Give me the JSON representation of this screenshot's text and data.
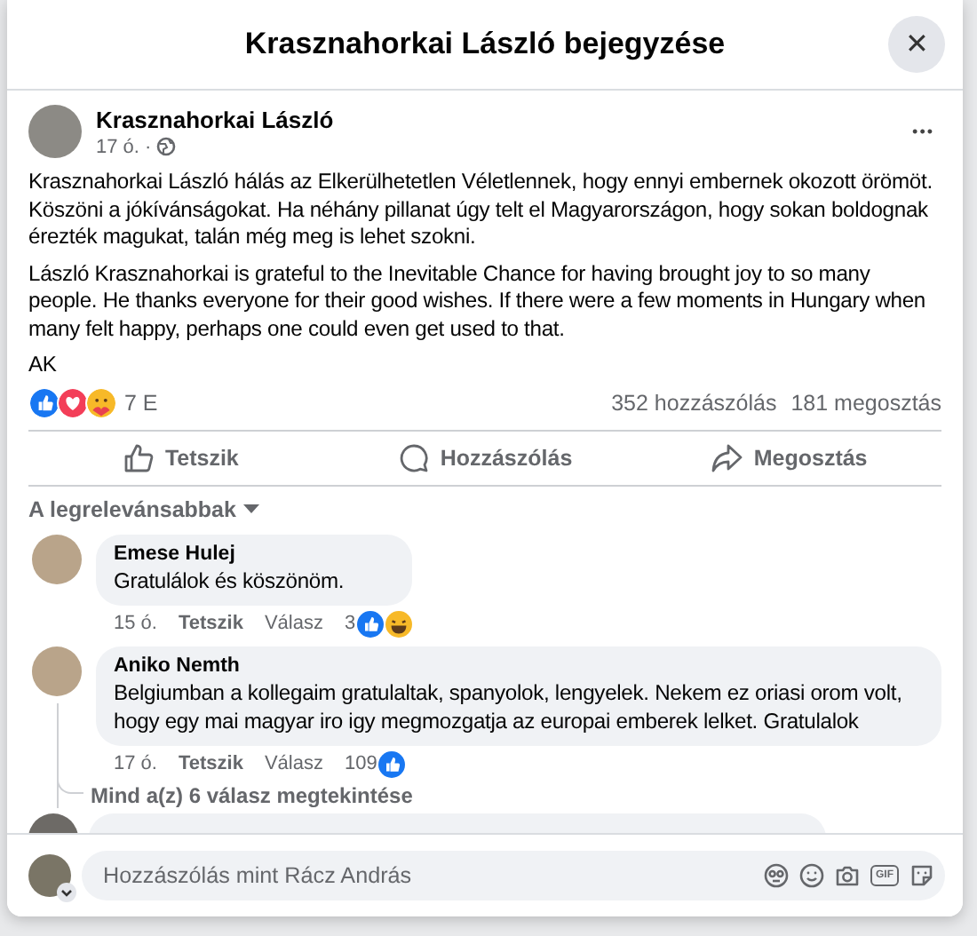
{
  "window": {
    "title": "Krasznahorkai László bejegyzése",
    "close": "✕"
  },
  "post": {
    "author": "Krasznahorkai László",
    "time": "17 ó. ·",
    "menu": "•••",
    "paragraphs": [
      "Krasznahorkai László hálás az Elkerülhetetlen Véletlennek, hogy ennyi embernek okozott örömöt. Köszöni a jókívánságokat. Ha néhány pillanat úgy telt el Magyarországon, hogy sokan boldognak érezték magukat, talán még meg is lehet szokni.",
      "László Krasznahorkai is grateful to the Inevitable Chance for having brought joy to so many people. He thanks everyone for their good wishes. If there were a few moments in Hungary when many felt happy, perhaps one could even get used to that.",
      "AK"
    ],
    "reactions": [
      {
        "kind": "like"
      },
      {
        "kind": "love"
      },
      {
        "kind": "care"
      }
    ],
    "reaction_count": "7 E",
    "comments_count": "352 hozzászólás",
    "shares_count": "181 megosztás",
    "actions": [
      {
        "kind": "like",
        "label": "Tetszik"
      },
      {
        "kind": "comment",
        "label": "Hozzászólás"
      },
      {
        "kind": "share",
        "label": "Megosztás"
      }
    ]
  },
  "sort": {
    "label": "A legrelevánsabbak"
  },
  "comments": [
    {
      "kind": "full",
      "author": "Emese Hulej",
      "text": "Gratulálok és köszönöm.",
      "time": "15 ó.",
      "like": "Tetszik",
      "reply": "Válasz",
      "count": "3",
      "reactions": [
        {
          "kind": "like"
        },
        {
          "kind": "haha"
        }
      ]
    },
    {
      "kind": "full",
      "author": "Aniko Nemth",
      "text": "Belgiumban a kollegaim gratulaltak, spanyolok, lengyelek. Nekem ez oriasi orom volt, hogy egy mai magyar iro igy megmozgatja az europai emberek lelket. Gratulalok",
      "time": "17 ó.",
      "like": "Tetszik",
      "reply": "Válasz",
      "count": "109",
      "reactions": [
        {
          "kind": "like"
        }
      ],
      "replies_link": "Mind a(z) 6 válasz megtekintése"
    },
    {
      "kind": "partial"
    }
  ],
  "composer": {
    "placeholder": "Hozzászólás mint Rácz András",
    "gif": "GIF"
  }
}
